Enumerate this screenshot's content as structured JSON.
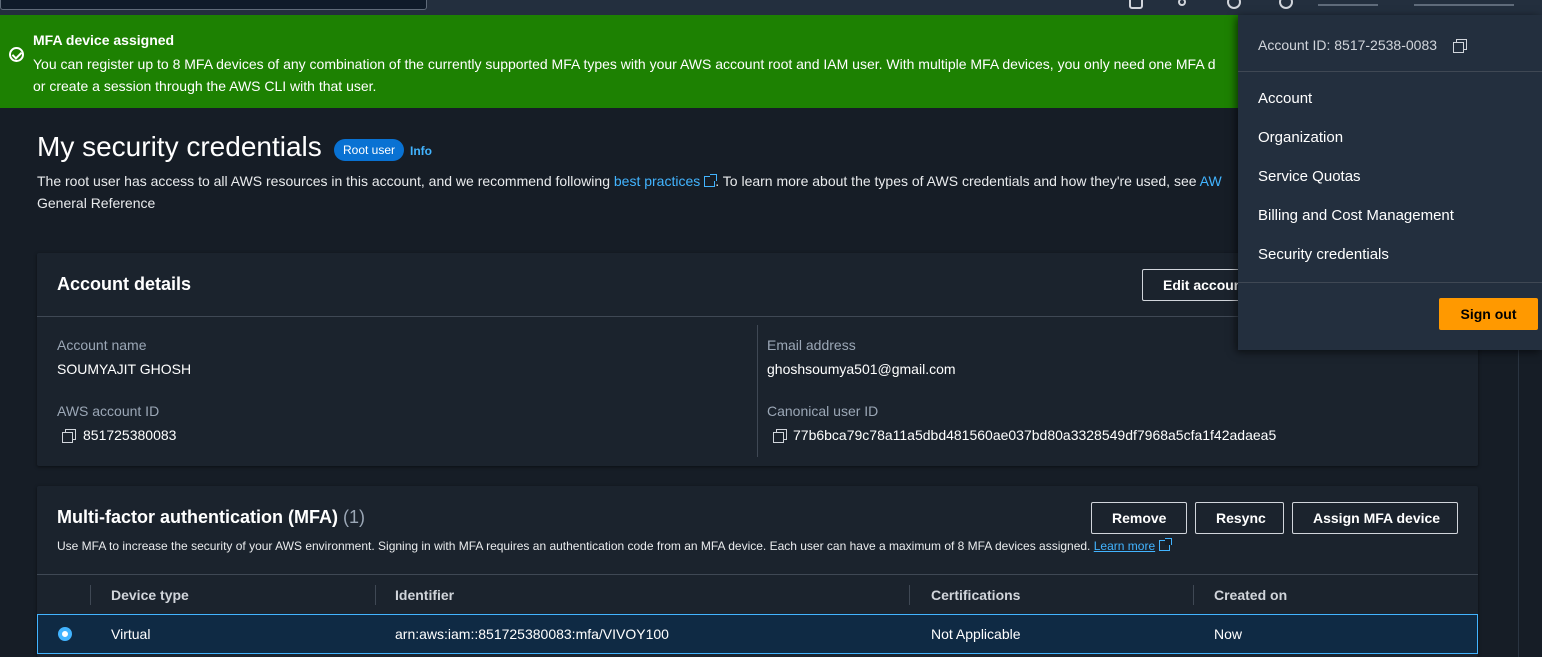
{
  "flash": {
    "title": "MFA device assigned",
    "body": "You can register up to 8 MFA devices of any combination of the currently supported MFA types with your AWS account root and IAM user. With multiple MFA devices, you only need one MFA d",
    "body2": "or create a session through the AWS CLI with that user."
  },
  "page": {
    "title": "My security credentials",
    "badge": "Root user",
    "info": "Info",
    "intro_pre": "The root user has access to all AWS resources in this account, and we recommend following ",
    "intro_link": "best practices",
    "intro_post": ". To learn more about the types of AWS credentials and how they're used, see ",
    "intro_link2": "AW",
    "intro_line2": "General Reference"
  },
  "account_details": {
    "title": "Account details",
    "edit_label": "Edit accoun",
    "account_name_label": "Account name",
    "account_name": "SOUMYAJIT GHOSH",
    "email_label": "Email address",
    "email": "ghoshsoumya501@gmail.com",
    "account_id_label": "AWS account ID",
    "account_id": "851725380083",
    "canonical_label": "Canonical user ID",
    "canonical_id": "77b6bca79c78a11a5dbd481560ae037bd80a3328549df7968a5cfa1f42adaea5"
  },
  "mfa": {
    "title": "Multi-factor authentication (MFA)",
    "count": "(1)",
    "remove_label": "Remove",
    "resync_label": "Resync",
    "assign_label": "Assign MFA device",
    "description": "Use MFA to increase the security of your AWS environment. Signing in with MFA requires an authentication code from an MFA device. Each user can have a maximum of 8 MFA devices assigned.",
    "learn_more": "Learn more",
    "columns": [
      "Device type",
      "Identifier",
      "Certifications",
      "Created on"
    ],
    "rows": [
      {
        "device_type": "Virtual",
        "identifier": "arn:aws:iam::851725380083:mfa/VIVOY100",
        "certifications": "Not Applicable",
        "created_on": "Now"
      }
    ]
  },
  "dropdown": {
    "account_id": "Account ID: 8517-2538-0083",
    "items": [
      "Account",
      "Organization",
      "Service Quotas",
      "Billing and Cost Management",
      "Security credentials"
    ],
    "sign_out": "Sign out"
  },
  "colors": {
    "flash_green": "#1d8102",
    "accent_blue": "#42b4ff",
    "signout_orange": "#ff9900",
    "badge_blue": "#0972d3"
  },
  "icons": [
    "success-check-icon",
    "external-link-icon",
    "copy-icon",
    "radio-selected-icon"
  ]
}
